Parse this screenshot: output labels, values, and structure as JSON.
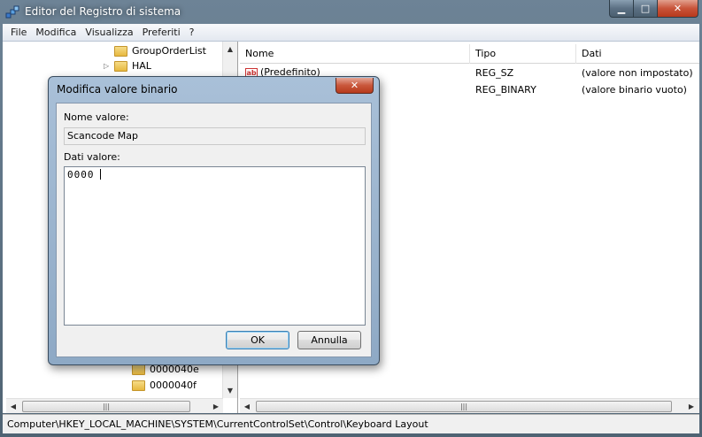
{
  "window": {
    "title": "Editor del Registro di sistema",
    "caption": {
      "minimize": "▁",
      "maximize": "□",
      "close": "✕"
    }
  },
  "menu": {
    "items": [
      "File",
      "Modifica",
      "Visualizza",
      "Preferiti",
      "?"
    ]
  },
  "tree": {
    "items_top": [
      {
        "label": "GroupOrderList",
        "expander": ""
      },
      {
        "label": "HAL",
        "expander": "▷"
      }
    ],
    "items_bottom": [
      {
        "label": "0000040e"
      },
      {
        "label": "0000040f"
      }
    ],
    "scroll": {
      "up": "▲",
      "down": "▼",
      "left": "◀",
      "right": "▶",
      "grip": "|||"
    }
  },
  "list": {
    "columns": [
      "Nome",
      "Tipo",
      "Dati"
    ],
    "rows": [
      {
        "name": "(Predefinito)",
        "type": "REG_SZ",
        "data": "(valore non impostato)",
        "icon": "string-value-icon"
      },
      {
        "name": "",
        "type": "REG_BINARY",
        "data": "(valore binario vuoto)",
        "icon": "binary-value-icon"
      }
    ]
  },
  "status": {
    "path": "Computer\\HKEY_LOCAL_MACHINE\\SYSTEM\\CurrentControlSet\\Control\\Keyboard Layout"
  },
  "dialog": {
    "title": "Modifica valore binario",
    "close": "✕",
    "name_label": "Nome valore:",
    "name_value": "Scancode Map",
    "data_label": "Dati valore:",
    "data_value": "0000",
    "ok_label": "OK",
    "cancel_label": "Annulla"
  }
}
